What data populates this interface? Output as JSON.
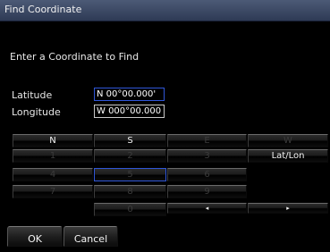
{
  "window": {
    "title": "Find Coordinate"
  },
  "prompt": "Enter a Coordinate to Find",
  "latitude": {
    "label": "Latitude",
    "value": "N 00°00.000'"
  },
  "longitude": {
    "label": "Longitude",
    "value": "W 000°00.000'"
  },
  "keypad": {
    "n": "N",
    "s": "S",
    "e": "E",
    "w": "W",
    "k1": "1",
    "k2": "2",
    "k3": "3",
    "latlon": "Lat/Lon",
    "k4": "4",
    "k5": "5",
    "k6": "6",
    "k7": "7",
    "k8": "8",
    "k9": "9",
    "k0": "0",
    "left": "◂",
    "right": "▸"
  },
  "buttons": {
    "ok": "OK",
    "cancel": "Cancel"
  }
}
